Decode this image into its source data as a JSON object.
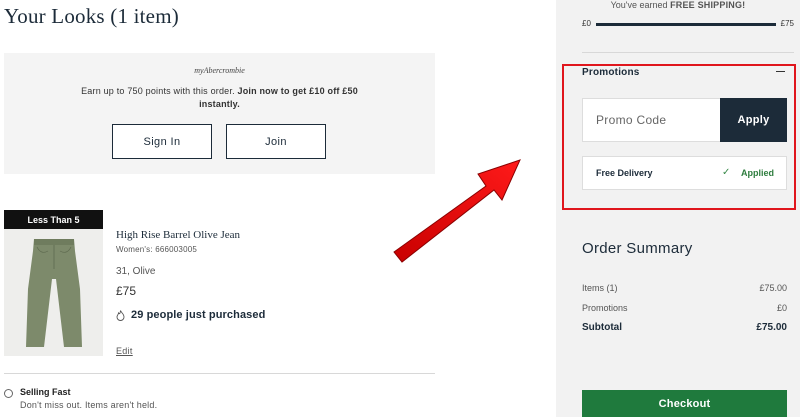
{
  "page_title": "Your Looks (1 item)",
  "loyalty": {
    "brand": "myAbercrombie",
    "message_prefix": "Earn up to 750 points with this order.",
    "message_bold": "Join now to get £10 off £50 instantly.",
    "sign_in_label": "Sign In",
    "join_label": "Join"
  },
  "product": {
    "stock_badge": "Less Than 5",
    "name": "High Rise Barrel Olive Jean",
    "id_line": "Women's: 666003005",
    "variant": "31, Olive",
    "price": "£75",
    "social_proof": "29 people just purchased",
    "edit_label": "Edit",
    "image_icon": "jeans-image"
  },
  "selling_fast": {
    "title": "Selling Fast",
    "subtitle": "Don't miss out. Items aren't held."
  },
  "shipping": {
    "message_prefix": "You've earned",
    "message_bold": "FREE SHIPPING!",
    "min_label": "£0",
    "max_label": "£75",
    "progress": 1.0
  },
  "promotions": {
    "title": "Promotions",
    "input_placeholder": "Promo Code",
    "input_value": "",
    "apply_label": "Apply",
    "applied": {
      "name": "Free Delivery",
      "status": "Applied"
    }
  },
  "order_summary": {
    "title": "Order Summary",
    "rows": [
      {
        "label": "Items (1)",
        "value": "£75.00"
      },
      {
        "label": "Promotions",
        "value": "£0"
      },
      {
        "label": "Subtotal",
        "value": "£75.00"
      }
    ]
  },
  "checkout_label": "Checkout",
  "colors": {
    "navy": "#1c2b39",
    "checkout_green": "#1f7a3d",
    "applied_green": "#2e7d3e",
    "highlight_red": "#e0161d",
    "panel_bg": "#f2f2f2"
  }
}
